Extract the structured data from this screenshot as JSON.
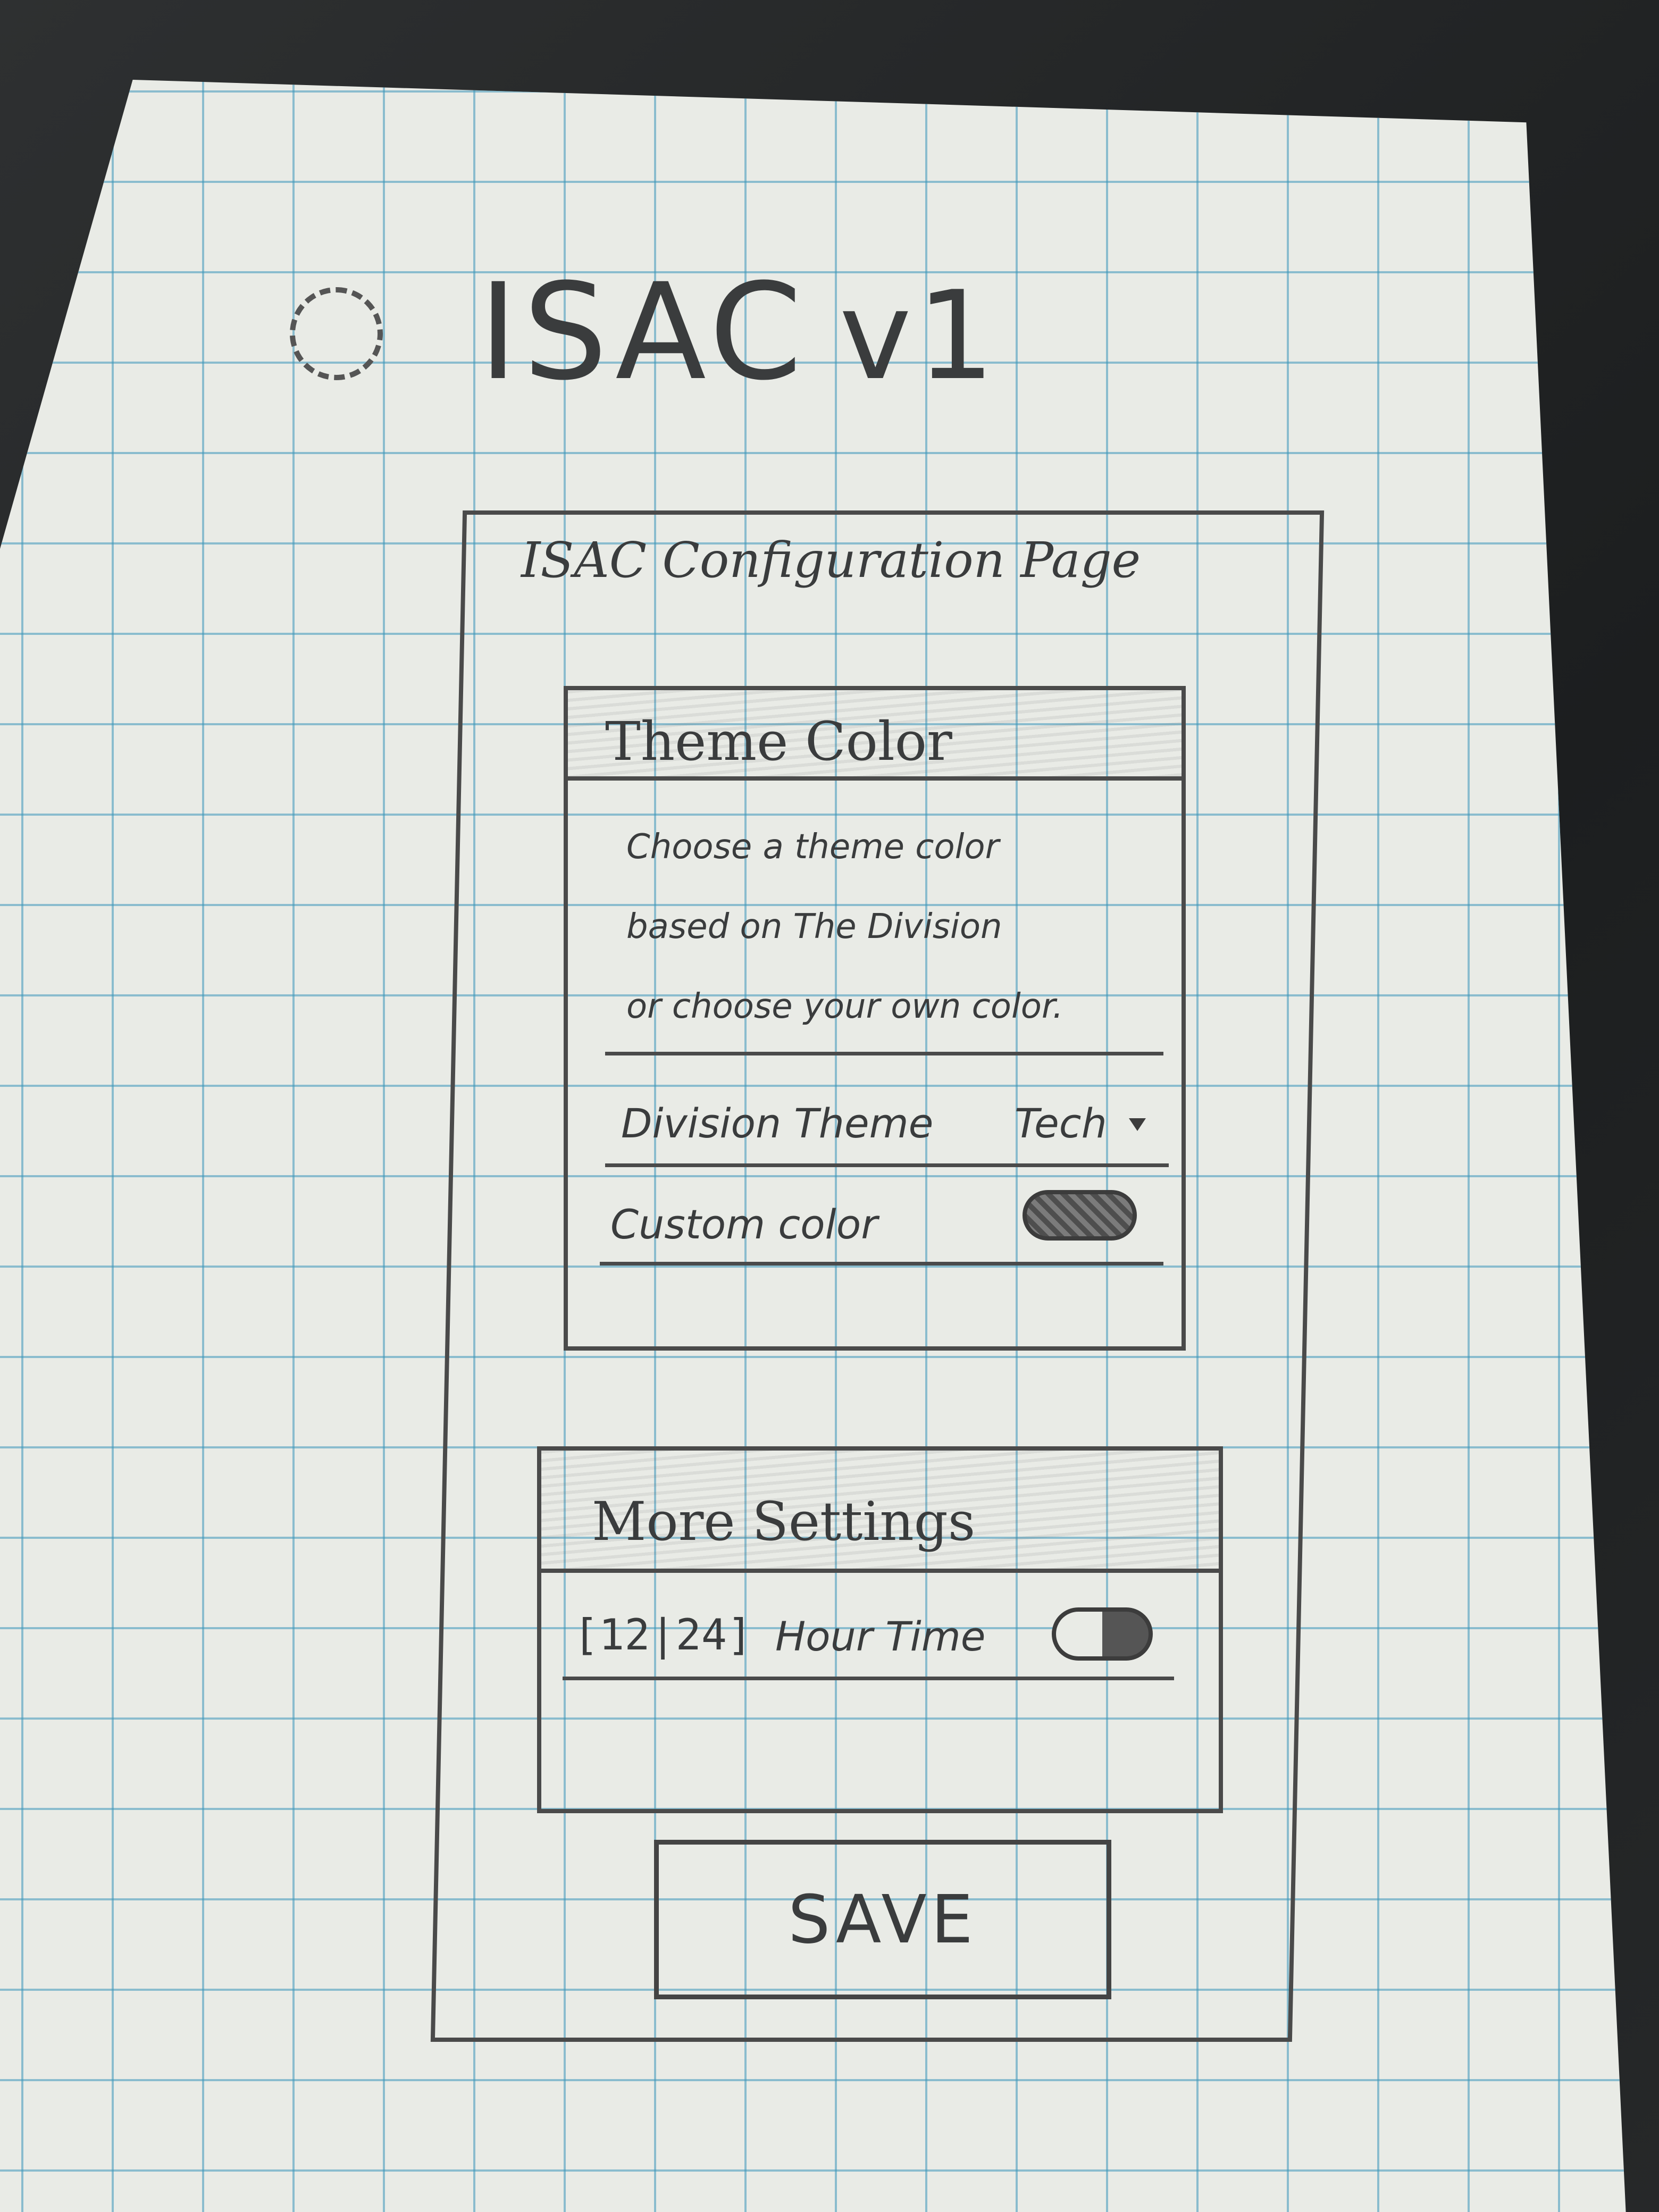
{
  "header": {
    "app_name": "ISAC",
    "version": "v1",
    "logo_icon": "gear-icon"
  },
  "page": {
    "title": "ISAC Configuration Page"
  },
  "theme_card": {
    "header": "Theme Color",
    "description": [
      "Choose a theme color",
      "based on The Division",
      "or choose your own color."
    ],
    "division_theme": {
      "label": "Division Theme",
      "value": "Tech"
    },
    "custom_color": {
      "label": "Custom color",
      "toggle_state": "on"
    }
  },
  "more_card": {
    "header": "More Settings",
    "time_format": {
      "options": [
        "12",
        "24"
      ],
      "label": "Hour Time",
      "toggle_state": "off"
    }
  },
  "actions": {
    "save_label": "SAVE"
  }
}
